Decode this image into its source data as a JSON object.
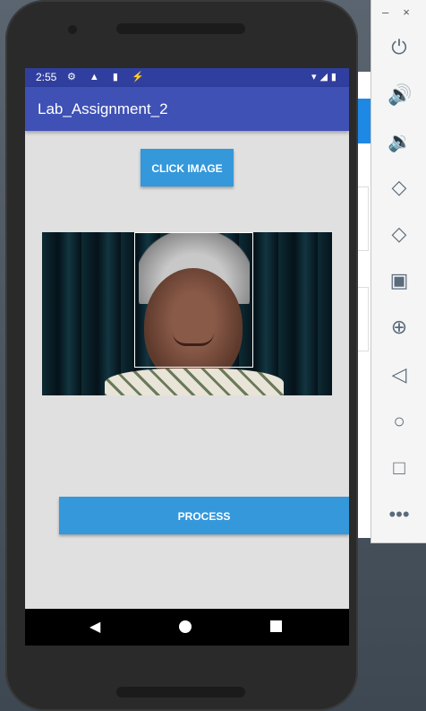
{
  "status_bar": {
    "time": "2:55",
    "notification_icons": "⚙ ▲ ▮ ⚡",
    "system_icons": "▾◢▮"
  },
  "app_bar": {
    "title": "Lab_Assignment_2"
  },
  "buttons": {
    "click_image": "CLICK IMAGE",
    "process": "PROCESS"
  },
  "side_panel": {
    "minimize": "–",
    "close": "×",
    "tools": [
      "power-icon",
      "volume-up-icon",
      "volume-down-icon",
      "rotate-left-icon",
      "rotate-right-icon",
      "camera-icon",
      "zoom-icon",
      "back-icon",
      "home-icon",
      "overview-icon",
      "more-icon"
    ]
  },
  "colors": {
    "status_bar": "#303f9f",
    "app_bar": "#3f51b5",
    "button": "#3498db",
    "screen_bg": "#e0e0e0"
  }
}
